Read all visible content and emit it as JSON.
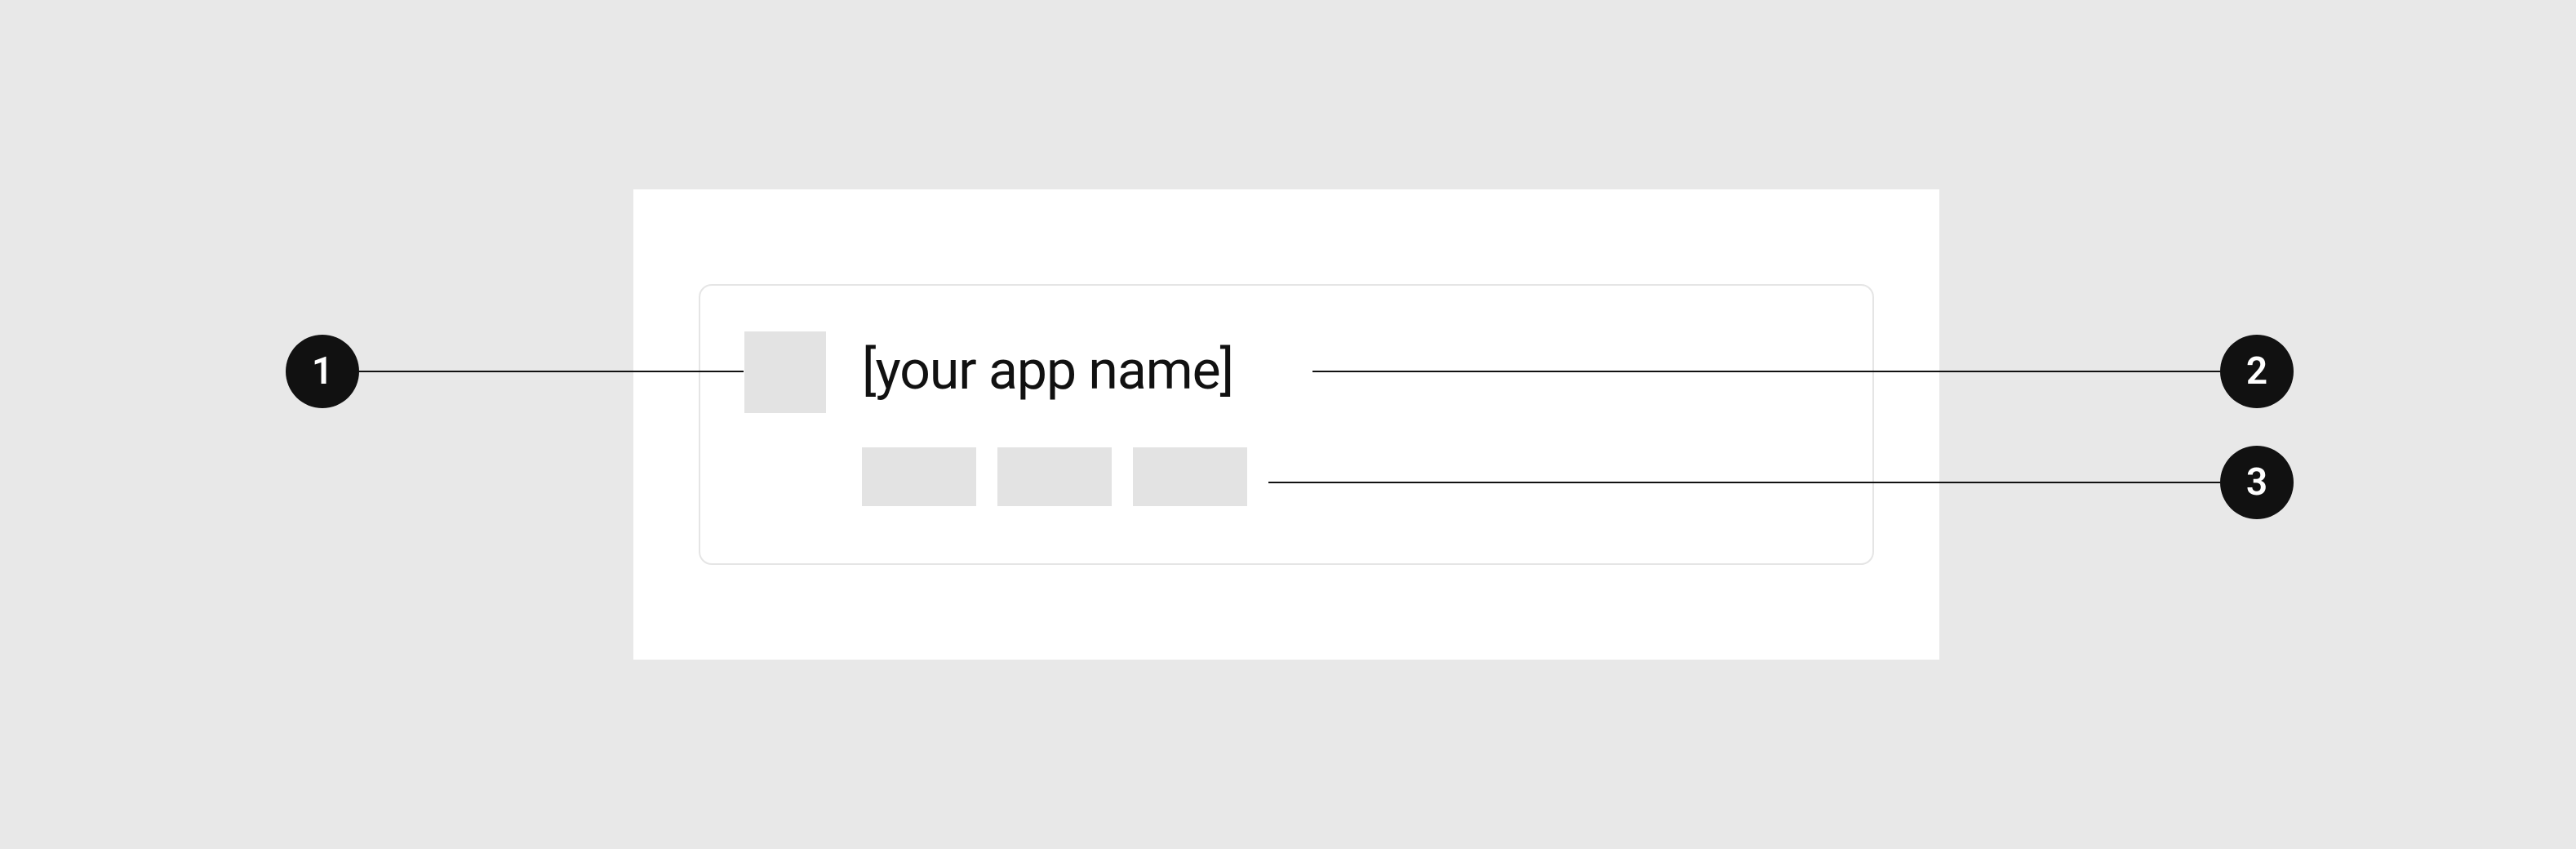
{
  "callouts": {
    "one": "1",
    "two": "2",
    "three": "3"
  },
  "card": {
    "app_name_label": "[your app name]"
  }
}
